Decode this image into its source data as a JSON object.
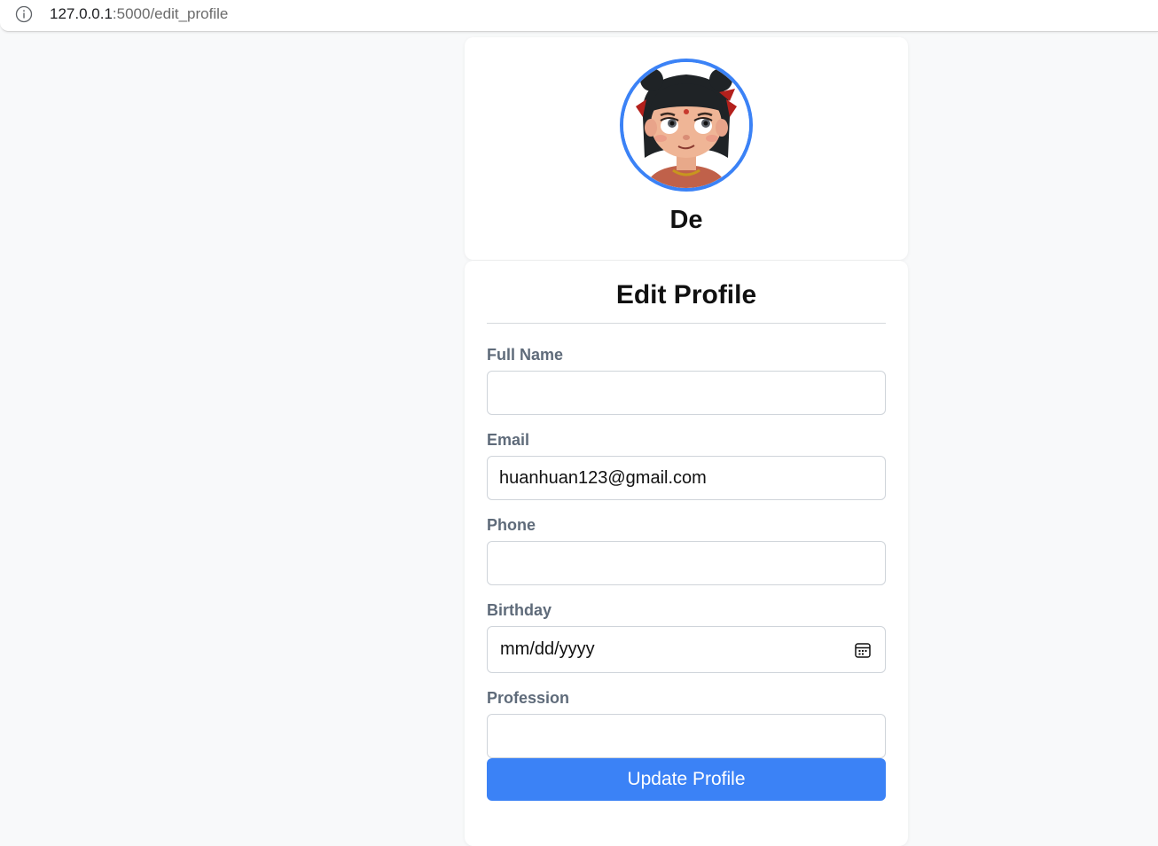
{
  "browser": {
    "url_host": "127.0.0.1",
    "url_rest": ":5000/edit_profile"
  },
  "profile": {
    "username": "De",
    "avatar": "cartoon-girl-avatar"
  },
  "form": {
    "title": "Edit Profile",
    "fields": [
      {
        "label": "Full Name",
        "value": ""
      },
      {
        "label": "Email",
        "value": "huanhuan123@gmail.com"
      },
      {
        "label": "Phone",
        "value": ""
      },
      {
        "label": "Birthday",
        "value": "mm/dd/yyyy",
        "icon": "calendar-icon"
      },
      {
        "label": "Profession",
        "value": ""
      }
    ],
    "submit_label": "Update Profile"
  },
  "colors": {
    "accent": "#3b82f6",
    "label": "#5f6b7a",
    "background": "#f8f9fa"
  }
}
